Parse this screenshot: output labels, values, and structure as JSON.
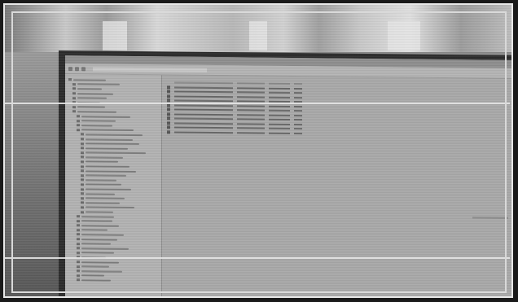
{
  "photo": {
    "subject": "",
    "colors": {
      "frame": "#e8e8e8",
      "screen": "#a9a9a9",
      "bezel": "#2b2b2b"
    }
  },
  "window": {
    "title": "",
    "address": ""
  },
  "tree_items": [
    {
      "label": "",
      "indent": 0
    },
    {
      "label": "",
      "indent": 1
    },
    {
      "label": "",
      "indent": 1
    },
    {
      "label": "",
      "indent": 1
    },
    {
      "label": "",
      "indent": 1
    },
    {
      "label": "",
      "indent": 1
    },
    {
      "label": "",
      "indent": 1
    },
    {
      "label": "",
      "indent": 1
    },
    {
      "label": "",
      "indent": 2
    },
    {
      "label": "",
      "indent": 2
    },
    {
      "label": "",
      "indent": 2
    },
    {
      "label": "",
      "indent": 2
    },
    {
      "label": "",
      "indent": 3
    },
    {
      "label": "",
      "indent": 3
    },
    {
      "label": "",
      "indent": 3
    },
    {
      "label": "",
      "indent": 3
    },
    {
      "label": "",
      "indent": 3
    },
    {
      "label": "",
      "indent": 3
    },
    {
      "label": "",
      "indent": 3
    },
    {
      "label": "",
      "indent": 3
    },
    {
      "label": "",
      "indent": 3
    },
    {
      "label": "",
      "indent": 3
    },
    {
      "label": "",
      "indent": 3
    },
    {
      "label": "",
      "indent": 3
    },
    {
      "label": "",
      "indent": 3
    },
    {
      "label": "",
      "indent": 3
    },
    {
      "label": "",
      "indent": 3
    },
    {
      "label": "",
      "indent": 3
    },
    {
      "label": "",
      "indent": 3
    },
    {
      "label": "",
      "indent": 3
    },
    {
      "label": "",
      "indent": 2
    },
    {
      "label": "",
      "indent": 2
    },
    {
      "label": "",
      "indent": 2
    },
    {
      "label": "",
      "indent": 2
    },
    {
      "label": "",
      "indent": 2
    },
    {
      "label": "",
      "indent": 2
    },
    {
      "label": "",
      "indent": 2
    },
    {
      "label": "",
      "indent": 2
    },
    {
      "label": "",
      "indent": 2
    },
    {
      "label": "",
      "indent": 2
    },
    {
      "label": "",
      "indent": 2
    },
    {
      "label": "",
      "indent": 2
    },
    {
      "label": "",
      "indent": 2
    },
    {
      "label": "",
      "indent": 2
    },
    {
      "label": "",
      "indent": 2
    }
  ],
  "file_list": {
    "headers": [
      "",
      "",
      "",
      ""
    ],
    "rows": [
      [
        "",
        "",
        "",
        ""
      ],
      [
        "",
        "",
        "",
        ""
      ],
      [
        "",
        "",
        "",
        ""
      ],
      [
        "",
        "",
        "",
        ""
      ],
      [
        "",
        "",
        "",
        ""
      ],
      [
        "",
        "",
        "",
        ""
      ],
      [
        "",
        "",
        "",
        ""
      ],
      [
        "",
        "",
        "",
        ""
      ],
      [
        "",
        "",
        "",
        ""
      ],
      [
        "",
        "",
        "",
        ""
      ],
      [
        "",
        "",
        "",
        ""
      ]
    ]
  }
}
